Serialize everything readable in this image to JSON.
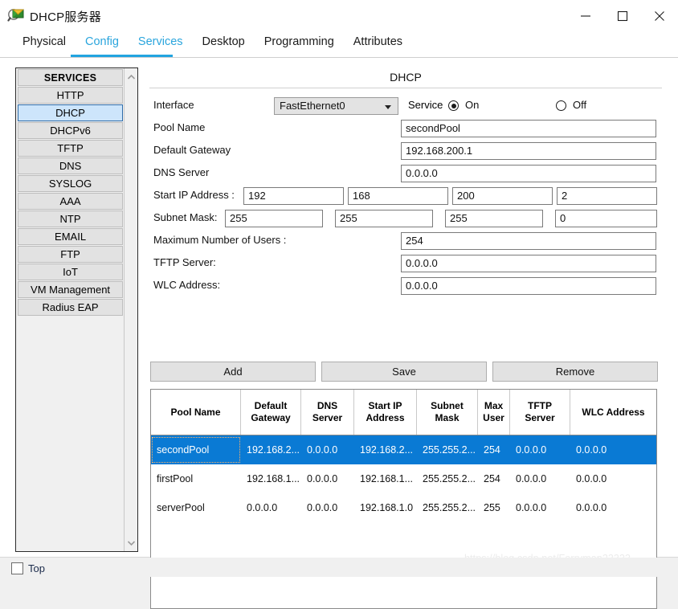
{
  "window": {
    "title": "DHCP服务器",
    "icon": "dhcp-server-icon",
    "controls": {
      "minimize": "minimize-icon",
      "maximize": "maximize-icon",
      "close": "close-icon"
    }
  },
  "tabs": [
    {
      "label": "Physical",
      "style": "plain"
    },
    {
      "label": "Config",
      "style": "link"
    },
    {
      "label": "Services",
      "style": "link"
    },
    {
      "label": "Desktop",
      "style": "plain"
    },
    {
      "label": "Programming",
      "style": "plain"
    },
    {
      "label": "Attributes",
      "style": "plain"
    }
  ],
  "sidebar": {
    "header": "SERVICES",
    "items": [
      {
        "label": "HTTP",
        "selected": false
      },
      {
        "label": "DHCP",
        "selected": true
      },
      {
        "label": "DHCPv6",
        "selected": false
      },
      {
        "label": "TFTP",
        "selected": false
      },
      {
        "label": "DNS",
        "selected": false
      },
      {
        "label": "SYSLOG",
        "selected": false
      },
      {
        "label": "AAA",
        "selected": false
      },
      {
        "label": "NTP",
        "selected": false
      },
      {
        "label": "EMAIL",
        "selected": false
      },
      {
        "label": "FTP",
        "selected": false
      },
      {
        "label": "IoT",
        "selected": false
      },
      {
        "label": "VM Management",
        "selected": false
      },
      {
        "label": "Radius EAP",
        "selected": false
      }
    ],
    "scroll_up": "chevron-up-icon",
    "scroll_down": "chevron-down-icon"
  },
  "panel": {
    "title": "DHCP",
    "interface": {
      "label": "Interface",
      "value": "FastEthernet0"
    },
    "service": {
      "label": "Service",
      "on_label": "On",
      "off_label": "Off",
      "selected": "On"
    },
    "pool_name": {
      "label": "Pool Name",
      "value": "secondPool"
    },
    "default_gateway": {
      "label": "Default Gateway",
      "value": "192.168.200.1"
    },
    "dns_server": {
      "label": "DNS Server",
      "value": "0.0.0.0"
    },
    "start_ip": {
      "label": "Start IP Address :",
      "octets": [
        "192",
        "168",
        "200",
        "2"
      ]
    },
    "subnet_mask": {
      "label": "Subnet Mask:",
      "octets": [
        "255",
        "255",
        "255",
        "0"
      ]
    },
    "max_users": {
      "label": "Maximum Number of Users :",
      "value": "254"
    },
    "tftp_server": {
      "label": "TFTP Server:",
      "value": "0.0.0.0"
    },
    "wlc_address": {
      "label": "WLC Address:",
      "value": "0.0.0.0"
    },
    "buttons": {
      "add": "Add",
      "save": "Save",
      "remove": "Remove"
    }
  },
  "table": {
    "columns": [
      "Pool\nName",
      "Default\nGateway",
      "DNS\nServer",
      "Start\nIP\nAddress",
      "Subnet\nMask",
      "Max\nUser",
      "TFTP\nServer",
      "WLC\nAddress"
    ],
    "columns_flat": [
      "Pool Name",
      "Default Gateway",
      "DNS Server",
      "Start IP Address",
      "Subnet Mask",
      "Max User",
      "TFTP Server",
      "WLC Address"
    ],
    "rows": [
      {
        "selected": true,
        "cells": [
          "secondPool",
          "192.168.2...",
          "0.0.0.0",
          "192.168.2...",
          "255.255.2...",
          "254",
          "0.0.0.0",
          "0.0.0.0"
        ]
      },
      {
        "selected": false,
        "cells": [
          "firstPool",
          "192.168.1...",
          "0.0.0.0",
          "192.168.1...",
          "255.255.2...",
          "254",
          "0.0.0.0",
          "0.0.0.0"
        ]
      },
      {
        "selected": false,
        "cells": [
          "serverPool",
          "0.0.0.0",
          "0.0.0.0",
          "192.168.1.0",
          "255.255.2...",
          "255",
          "0.0.0.0",
          "0.0.0.0"
        ]
      }
    ]
  },
  "watermark": "https://blog.csdn.net/Ferryman23333",
  "bottom": {
    "top_checkbox_label": "Top",
    "checked": false
  },
  "colors": {
    "accent": "#22a4e0",
    "selection": "#0a7ad4",
    "sidebar_selected": "#cde5fb",
    "button_face": "#e2e2e2"
  }
}
